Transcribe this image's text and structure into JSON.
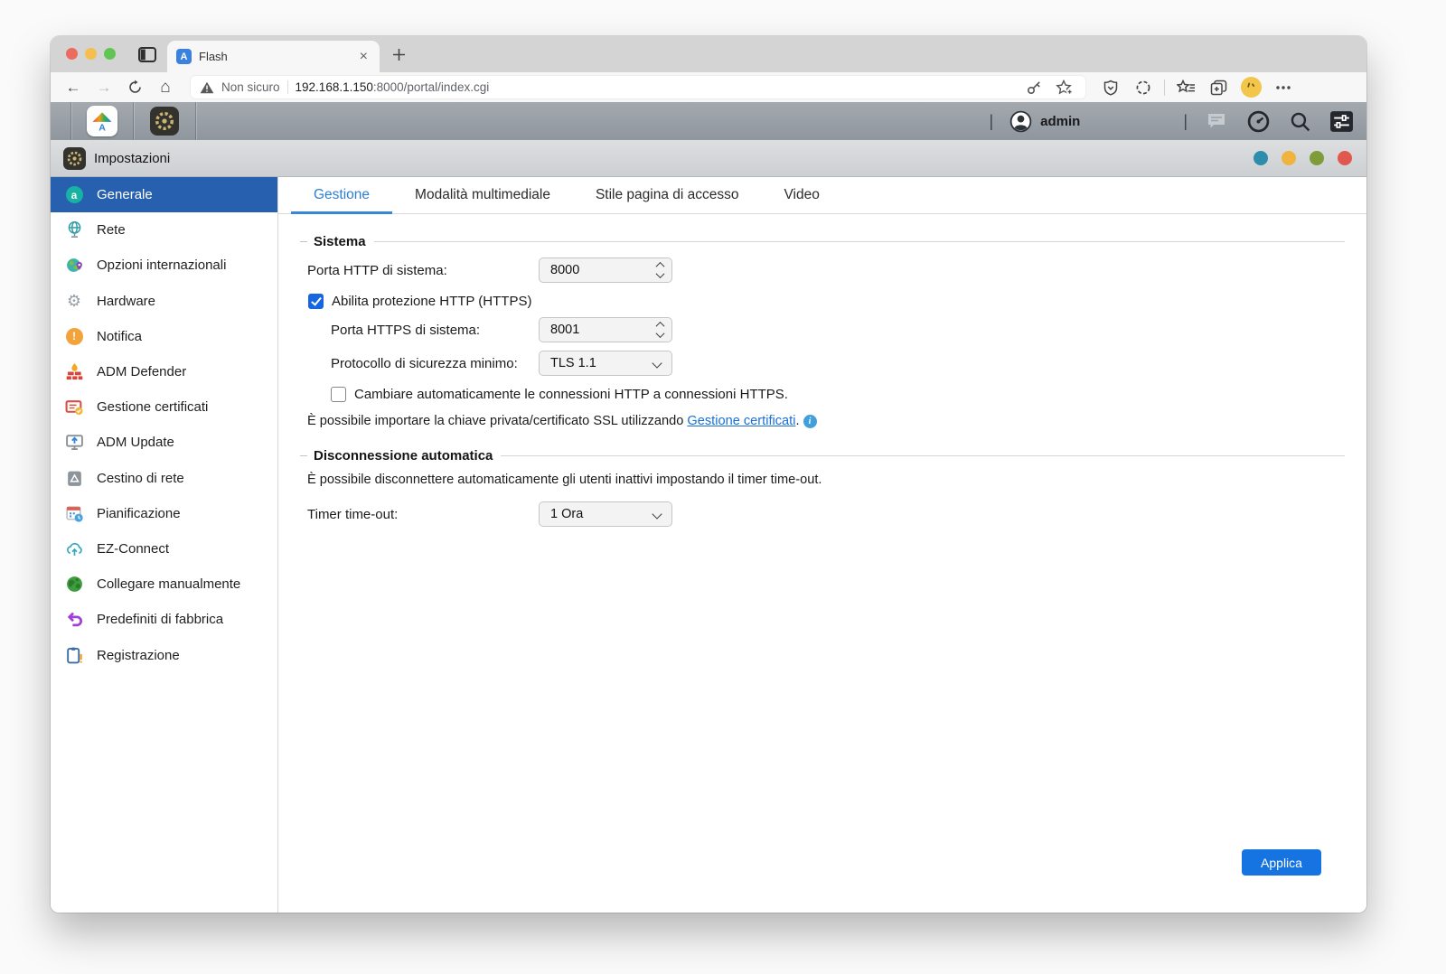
{
  "browser": {
    "tab_title": "Flash",
    "security_label": "Non sicuro",
    "url_host": "192.168.1.150",
    "url_rest": ":8000/portal/index.cgi"
  },
  "taskbar": {
    "username": "admin"
  },
  "app_window": {
    "title": "Impostazioni"
  },
  "sidebar": {
    "items": [
      "Generale",
      "Rete",
      "Opzioni internazionali",
      "Hardware",
      "Notifica",
      "ADM Defender",
      "Gestione certificati",
      "ADM Update",
      "Cestino di rete",
      "Pianificazione",
      "EZ-Connect",
      "Collegare manualmente",
      "Predefiniti di fabbrica",
      "Registrazione"
    ]
  },
  "tabs": [
    "Gestione",
    "Modalità multimediale",
    "Stile pagina di accesso",
    "Video"
  ],
  "sistema": {
    "legend": "Sistema",
    "http_port_label": "Porta HTTP di sistema:",
    "http_port_value": "8000",
    "https_enable_label": "Abilita protezione HTTP (HTTPS)",
    "https_port_label": "Porta HTTPS di sistema:",
    "https_port_value": "8001",
    "min_protocol_label": "Protocollo di sicurezza minimo:",
    "min_protocol_value": "TLS 1.1",
    "auto_redirect_label": "Cambiare automaticamente le connessioni HTTP a connessioni HTTPS.",
    "ssl_note_prefix": "È possibile importare la chiave privata/certificato SSL utilizzando",
    "ssl_note_link": "Gestione certificati",
    "ssl_note_suffix": "."
  },
  "auto_logout": {
    "legend": "Disconnessione automatica",
    "description": "È possibile disconnettere automaticamente gli utenti inattivi impostando il timer time-out.",
    "timeout_label": "Timer time-out:",
    "timeout_value": "1 Ora"
  },
  "actions": {
    "apply_label": "Applica"
  },
  "glyphs": {
    "back": "←",
    "forward": "→",
    "home": "⌂",
    "close_tab": "×",
    "pipe": "|",
    "hardware": "⚙",
    "alert": "!",
    "generale": "a",
    "logo": "A",
    "info": "i"
  },
  "colors": {
    "sidebar_selected": "#2760ae",
    "tab_active": "#2e7fd4",
    "apply_button": "#1673e2",
    "link": "#1b6fd8",
    "traffic_lights": [
      "#ec6a5e",
      "#f4bf4f",
      "#61c554"
    ],
    "window_dots": [
      "#2e8dac",
      "#efb340",
      "#7e9c3a",
      "#e0584e"
    ]
  }
}
